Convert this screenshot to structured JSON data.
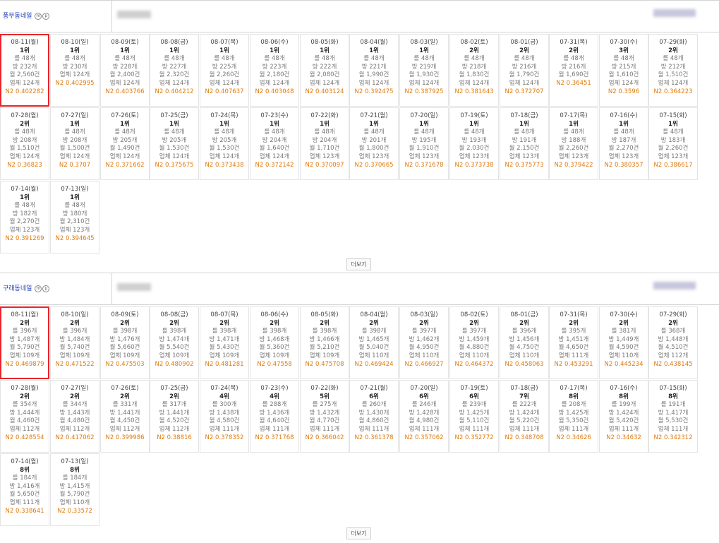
{
  "more_label": "더보기",
  "sections": [
    {
      "title": "풍무동네일",
      "badges": [
        "m",
        "p"
      ],
      "cards": [
        {
          "date": "08-11(월)",
          "rank": "1위",
          "a": "를 48개",
          "b": "방 232개",
          "c": "월 2,560건",
          "d": "업체 124개",
          "n2": "N2 0.402282"
        },
        {
          "date": "08-10(일)",
          "rank": "1위",
          "a": "를 48개",
          "b": "방 230개",
          "c": "업체 124개",
          "d": "N2 0.402995",
          "n2": ""
        },
        {
          "date": "08-09(토)",
          "rank": "1위",
          "a": "를 48개",
          "b": "방 228개",
          "c": "월 2,400건",
          "d": "업체 124개",
          "n2": "N2 0.403766"
        },
        {
          "date": "08-08(금)",
          "rank": "1위",
          "a": "를 48개",
          "b": "방 227개",
          "c": "월 2,320건",
          "d": "업체 124개",
          "n2": "N2 0.404212"
        },
        {
          "date": "08-07(목)",
          "rank": "1위",
          "a": "를 48개",
          "b": "방 225개",
          "c": "월 2,260건",
          "d": "업체 124개",
          "n2": "N2 0.407637"
        },
        {
          "date": "08-06(수)",
          "rank": "1위",
          "a": "를 48개",
          "b": "방 223개",
          "c": "월 2,180건",
          "d": "업체 124개",
          "n2": "N2 0.403048"
        },
        {
          "date": "08-05(화)",
          "rank": "1위",
          "a": "를 48개",
          "b": "방 222개",
          "c": "월 2,080건",
          "d": "업체 124개",
          "n2": "N2 0.403124"
        },
        {
          "date": "08-04(월)",
          "rank": "1위",
          "a": "를 48개",
          "b": "방 221개",
          "c": "월 1,990건",
          "d": "업체 124개",
          "n2": "N2 0.392475"
        },
        {
          "date": "08-03(일)",
          "rank": "1위",
          "a": "를 48개",
          "b": "방 219개",
          "c": "월 1,930건",
          "d": "업체 124개",
          "n2": "N2 0.387925"
        },
        {
          "date": "08-02(토)",
          "rank": "2위",
          "a": "를 48개",
          "b": "방 218개",
          "c": "월 1,830건",
          "d": "업체 124개",
          "n2": "N2 0.381643"
        },
        {
          "date": "08-01(금)",
          "rank": "2위",
          "a": "를 48개",
          "b": "방 216개",
          "c": "월 1,790건",
          "d": "업체 124개",
          "n2": "N2 0.372707"
        },
        {
          "date": "07-31(목)",
          "rank": "2위",
          "a": "를 48개",
          "b": "방 216개",
          "c": "월 1,690건",
          "d": "N2 0.36451",
          "n2": ""
        },
        {
          "date": "07-30(수)",
          "rank": "3위",
          "a": "를 48개",
          "b": "방 215개",
          "c": "월 1,610건",
          "d": "업체 124개",
          "n2": "N2 0.3596"
        },
        {
          "date": "07-29(화)",
          "rank": "2위",
          "a": "를 48개",
          "b": "방 212개",
          "c": "월 1,510건",
          "d": "업체 124개",
          "n2": "N2 0.364223"
        },
        {
          "date": "07-28(월)",
          "rank": "2위",
          "a": "를 48개",
          "b": "방 208개",
          "c": "월 1,510건",
          "d": "업체 124개",
          "n2": "N2 0.36823"
        },
        {
          "date": "07-27(일)",
          "rank": "1위",
          "a": "를 48개",
          "b": "방 208개",
          "c": "월 1,500건",
          "d": "업체 124개",
          "n2": "N2 0.3707"
        },
        {
          "date": "07-26(토)",
          "rank": "1위",
          "a": "를 48개",
          "b": "방 205개",
          "c": "월 1,490건",
          "d": "업체 124개",
          "n2": "N2 0.371662"
        },
        {
          "date": "07-25(금)",
          "rank": "1위",
          "a": "를 48개",
          "b": "방 205개",
          "c": "월 1,530건",
          "d": "업체 124개",
          "n2": "N2 0.375675"
        },
        {
          "date": "07-24(목)",
          "rank": "1위",
          "a": "를 48개",
          "b": "방 205개",
          "c": "월 1,530건",
          "d": "업체 124개",
          "n2": "N2 0.373438"
        },
        {
          "date": "07-23(수)",
          "rank": "1위",
          "a": "를 48개",
          "b": "방 204개",
          "c": "월 1,640건",
          "d": "업체 124개",
          "n2": "N2 0.372142"
        },
        {
          "date": "07-22(화)",
          "rank": "1위",
          "a": "를 48개",
          "b": "방 204개",
          "c": "월 1,710건",
          "d": "업체 123개",
          "n2": "N2 0.370097"
        },
        {
          "date": "07-21(월)",
          "rank": "1위",
          "a": "를 48개",
          "b": "방 201개",
          "c": "월 1,800건",
          "d": "업체 123개",
          "n2": "N2 0.370665"
        },
        {
          "date": "07-20(일)",
          "rank": "1위",
          "a": "를 48개",
          "b": "방 195개",
          "c": "월 1,910건",
          "d": "업체 123개",
          "n2": "N2 0.371678"
        },
        {
          "date": "07-19(토)",
          "rank": "1위",
          "a": "를 48개",
          "b": "방 193개",
          "c": "월 2,030건",
          "d": "업체 123개",
          "n2": "N2 0.373738"
        },
        {
          "date": "07-18(금)",
          "rank": "1위",
          "a": "를 48개",
          "b": "방 191개",
          "c": "월 2,150건",
          "d": "업체 123개",
          "n2": "N2 0.375773"
        },
        {
          "date": "07-17(목)",
          "rank": "1위",
          "a": "를 48개",
          "b": "방 188개",
          "c": "월 2,260건",
          "d": "업체 123개",
          "n2": "N2 0.379422"
        },
        {
          "date": "07-16(수)",
          "rank": "1위",
          "a": "를 48개",
          "b": "방 187개",
          "c": "월 2,270건",
          "d": "업체 123개",
          "n2": "N2 0.380357"
        },
        {
          "date": "07-15(화)",
          "rank": "1위",
          "a": "를 48개",
          "b": "방 183개",
          "c": "월 2,260건",
          "d": "업체 123개",
          "n2": "N2 0.386617"
        },
        {
          "date": "07-14(월)",
          "rank": "1위",
          "a": "를 48개",
          "b": "방 182개",
          "c": "월 2,270건",
          "d": "업체 123개",
          "n2": "N2 0.391269"
        },
        {
          "date": "07-13(일)",
          "rank": "1위",
          "a": "를 48개",
          "b": "방 180개",
          "c": "월 2,310건",
          "d": "업체 123개",
          "n2": "N2 0.394645"
        }
      ]
    },
    {
      "title": "구래동네일",
      "badges": [
        "m",
        "p"
      ],
      "cards": [
        {
          "date": "08-11(월)",
          "rank": "2위",
          "a": "를 396개",
          "b": "방 1,487개",
          "c": "월 5,790건",
          "d": "업체 109개",
          "n2": "N2 0.469879"
        },
        {
          "date": "08-10(일)",
          "rank": "2위",
          "a": "를 396개",
          "b": "방 1,484개",
          "c": "월 5,740건",
          "d": "업체 109개",
          "n2": "N2 0.471522"
        },
        {
          "date": "08-09(토)",
          "rank": "2위",
          "a": "를 398개",
          "b": "방 1,476개",
          "c": "월 5,660건",
          "d": "업체 109개",
          "n2": "N2 0.475503"
        },
        {
          "date": "08-08(금)",
          "rank": "2위",
          "a": "를 398개",
          "b": "방 1,474개",
          "c": "월 5,540건",
          "d": "업체 109개",
          "n2": "N2 0.480902"
        },
        {
          "date": "08-07(목)",
          "rank": "2위",
          "a": "를 398개",
          "b": "방 1,471개",
          "c": "월 5,430건",
          "d": "업체 109개",
          "n2": "N2 0.481281"
        },
        {
          "date": "08-06(수)",
          "rank": "2위",
          "a": "를 398개",
          "b": "방 1,468개",
          "c": "월 5,360건",
          "d": "업체 109개",
          "n2": "N2 0.47558"
        },
        {
          "date": "08-05(화)",
          "rank": "2위",
          "a": "를 398개",
          "b": "방 1,466개",
          "c": "월 5,210건",
          "d": "업체 109개",
          "n2": "N2 0.475708"
        },
        {
          "date": "08-04(월)",
          "rank": "2위",
          "a": "를 398개",
          "b": "방 1,465개",
          "c": "월 5,040건",
          "d": "업체 110개",
          "n2": "N2 0.469424"
        },
        {
          "date": "08-03(일)",
          "rank": "2위",
          "a": "를 397개",
          "b": "방 1,462개",
          "c": "월 4,950건",
          "d": "업체 110개",
          "n2": "N2 0.466927"
        },
        {
          "date": "08-02(토)",
          "rank": "2위",
          "a": "를 397개",
          "b": "방 1,459개",
          "c": "월 4,880건",
          "d": "업체 110개",
          "n2": "N2 0.464372"
        },
        {
          "date": "08-01(금)",
          "rank": "2위",
          "a": "를 396개",
          "b": "방 1,456개",
          "c": "월 4,750건",
          "d": "업체 110개",
          "n2": "N2 0.458063"
        },
        {
          "date": "07-31(목)",
          "rank": "2위",
          "a": "를 395개",
          "b": "방 1,451개",
          "c": "월 4,650건",
          "d": "업체 111개",
          "n2": "N2 0.453291"
        },
        {
          "date": "07-30(수)",
          "rank": "2위",
          "a": "를 381개",
          "b": "방 1,449개",
          "c": "월 4,590건",
          "d": "업체 110개",
          "n2": "N2 0.445234"
        },
        {
          "date": "07-29(화)",
          "rank": "2위",
          "a": "를 368개",
          "b": "방 1,448개",
          "c": "월 4,510건",
          "d": "업체 112개",
          "n2": "N2 0.438145"
        },
        {
          "date": "07-28(월)",
          "rank": "2위",
          "a": "를 354개",
          "b": "방 1,444개",
          "c": "월 4,460건",
          "d": "업체 112개",
          "n2": "N2 0.428554"
        },
        {
          "date": "07-27(일)",
          "rank": "2위",
          "a": "를 344개",
          "b": "방 1,443개",
          "c": "월 4,480건",
          "d": "업체 112개",
          "n2": "N2 0.417062"
        },
        {
          "date": "07-26(토)",
          "rank": "2위",
          "a": "를 331개",
          "b": "방 1,441개",
          "c": "월 4,450건",
          "d": "업체 112개",
          "n2": "N2 0.399986"
        },
        {
          "date": "07-25(금)",
          "rank": "2위",
          "a": "를 317개",
          "b": "방 1,441개",
          "c": "월 4,520건",
          "d": "업체 112개",
          "n2": "N2 0.38816"
        },
        {
          "date": "07-24(목)",
          "rank": "4위",
          "a": "를 300개",
          "b": "방 1,438개",
          "c": "월 4,580건",
          "d": "업체 111개",
          "n2": "N2 0.378352"
        },
        {
          "date": "07-23(수)",
          "rank": "4위",
          "a": "를 288개",
          "b": "방 1,436개",
          "c": "월 4,640건",
          "d": "업체 111개",
          "n2": "N2 0.371768"
        },
        {
          "date": "07-22(화)",
          "rank": "5위",
          "a": "를 275개",
          "b": "방 1,432개",
          "c": "월 4,770건",
          "d": "업체 111개",
          "n2": "N2 0.366042"
        },
        {
          "date": "07-21(월)",
          "rank": "6위",
          "a": "를 260개",
          "b": "방 1,430개",
          "c": "월 4,860건",
          "d": "업체 111개",
          "n2": "N2 0.361378"
        },
        {
          "date": "07-20(일)",
          "rank": "6위",
          "a": "를 246개",
          "b": "방 1,428개",
          "c": "월 4,980건",
          "d": "업체 111개",
          "n2": "N2 0.357062"
        },
        {
          "date": "07-19(토)",
          "rank": "6위",
          "a": "를 239개",
          "b": "방 1,425개",
          "c": "월 5,110건",
          "d": "업체 111개",
          "n2": "N2 0.352772"
        },
        {
          "date": "07-18(금)",
          "rank": "7위",
          "a": "를 222개",
          "b": "방 1,424개",
          "c": "월 5,220건",
          "d": "업체 111개",
          "n2": "N2 0.348708"
        },
        {
          "date": "07-17(목)",
          "rank": "8위",
          "a": "를 208개",
          "b": "방 1,425개",
          "c": "월 5,350건",
          "d": "업체 111개",
          "n2": "N2 0.34626"
        },
        {
          "date": "07-16(수)",
          "rank": "8위",
          "a": "를 199개",
          "b": "방 1,424개",
          "c": "월 5,420건",
          "d": "업체 111개",
          "n2": "N2 0.34632"
        },
        {
          "date": "07-15(화)",
          "rank": "8위",
          "a": "를 191개",
          "b": "방 1,417개",
          "c": "월 5,530건",
          "d": "업체 111개",
          "n2": "N2 0.342312"
        },
        {
          "date": "07-14(월)",
          "rank": "8위",
          "a": "를 184개",
          "b": "방 1,416개",
          "c": "월 5,650건",
          "d": "업체 111개",
          "n2": "N2 0.338641"
        },
        {
          "date": "07-13(일)",
          "rank": "8위",
          "a": "를 184개",
          "b": "방 1,415개",
          "c": "월 5,790건",
          "d": "업체 110개",
          "n2": "N2 0.33572"
        }
      ]
    }
  ]
}
